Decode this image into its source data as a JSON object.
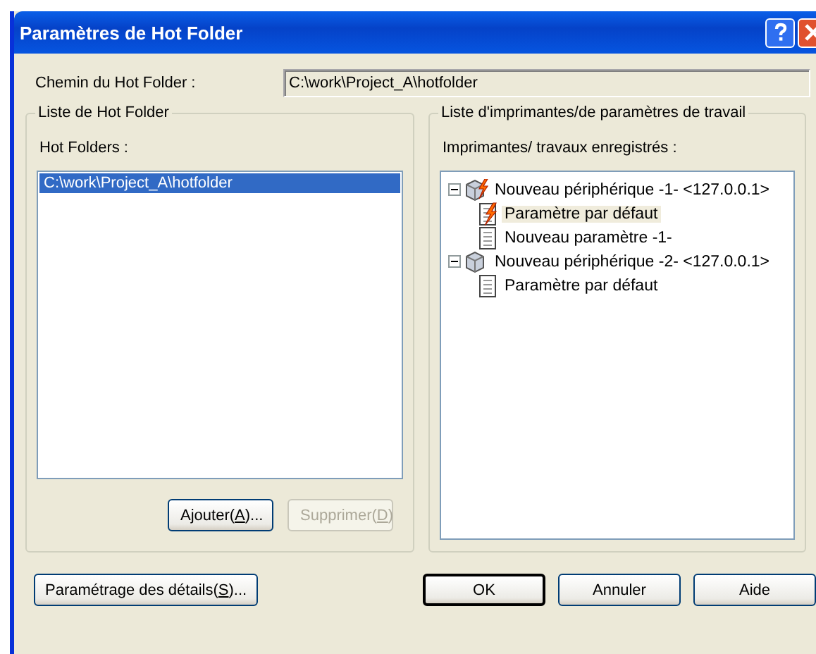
{
  "window": {
    "title": "Paramètres de Hot Folder"
  },
  "path": {
    "label": "Chemin du Hot Folder :",
    "value": "C:\\work\\Project_A\\hotfolder"
  },
  "hot_folder_group": {
    "title": "Liste de Hot Folder",
    "list_label": "Hot Folders :",
    "items": [
      {
        "text": "C:\\work\\Project_A\\hotfolder",
        "selected": true
      }
    ],
    "buttons": [
      {
        "before": "Ajouter(",
        "accel": "A",
        "after": ")...",
        "disabled": false
      },
      {
        "before": "Supprimer(",
        "accel": "D",
        "after": ")",
        "disabled": true
      }
    ]
  },
  "printer_group": {
    "title": "Liste d'imprimantes/de paramètres de travail",
    "list_label": "Imprimantes/ travaux enregistrés :",
    "tree": [
      {
        "text": "Nouveau périphérique -1- <127.0.0.1>",
        "expanded": true,
        "active": true,
        "selected": false,
        "children": [
          {
            "text": "Paramètre par défaut",
            "active": true,
            "selected": true
          },
          {
            "text": "Nouveau paramètre -1-",
            "active": false,
            "selected": false
          }
        ]
      },
      {
        "text": "Nouveau périphérique -2- <127.0.0.1>",
        "expanded": true,
        "active": false,
        "selected": false,
        "children": [
          {
            "text": "Paramètre par défaut",
            "active": false,
            "selected": false
          }
        ]
      }
    ]
  },
  "footer": {
    "details_button": {
      "before": "Paramétrage des détails(",
      "accel": "S",
      "after": ")..."
    },
    "buttons": [
      {
        "text": "OK",
        "default": true
      },
      {
        "text": "Annuler",
        "default": false
      },
      {
        "text": "Aide",
        "default": false
      }
    ]
  }
}
